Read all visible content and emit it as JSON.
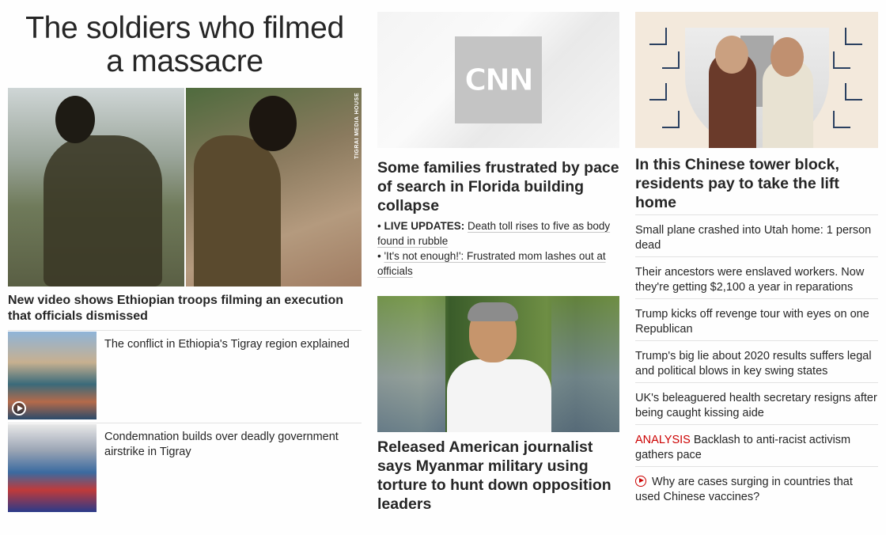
{
  "col1": {
    "big_title_line1": "The soldiers who filmed",
    "big_title_line2": "a massacre",
    "image_watermark": "TIGRAI MEDIA HOUSE",
    "lead_headline": "New video shows Ethiopian troops filming an execution that officials dismissed",
    "sub_stories": [
      {
        "text": "The conflict in Ethiopia's Tigray region explained",
        "has_video": true
      },
      {
        "text": "Condemnation builds over deadly government airstrike in Tigray",
        "has_video": false
      }
    ]
  },
  "col2": {
    "logo_text": "CNN",
    "headline": "Some families frustrated by pace of search in Florida building collapse",
    "bullets": [
      {
        "prefix": "LIVE UPDATES:",
        "text": "Death toll rises to five as body found in rubble"
      },
      {
        "prefix": "",
        "text": "'It's not enough!': Frustrated mom lashes out at officials"
      }
    ],
    "headline2": "Released American journalist says Myanmar military using torture to hunt down opposition leaders"
  },
  "col3": {
    "headline": "In this Chinese tower block, residents pay to take the lift home",
    "items": [
      {
        "label": "",
        "text": "Small plane crashed into Utah home: 1 person dead",
        "video": false
      },
      {
        "label": "",
        "text": "Their ancestors were enslaved workers. Now they're getting $2,100 a year in reparations",
        "video": false
      },
      {
        "label": "",
        "text": "Trump kicks off revenge tour with eyes on one Republican",
        "video": false
      },
      {
        "label": "",
        "text": "Trump's big lie about 2020 results suffers legal and political blows in key swing states",
        "video": false
      },
      {
        "label": "",
        "text": "UK's beleaguered health secretary resigns after being caught kissing aide",
        "video": false
      },
      {
        "label": "ANALYSIS",
        "text": "Backlash to anti-racist activism gathers pace",
        "video": false
      },
      {
        "label": "",
        "text": "Why are cases surging in countries that used Chinese vaccines?",
        "video": true
      }
    ]
  },
  "colors": {
    "accent_red": "#cc0000",
    "text": "#262626",
    "divider": "#e2e2e2"
  }
}
